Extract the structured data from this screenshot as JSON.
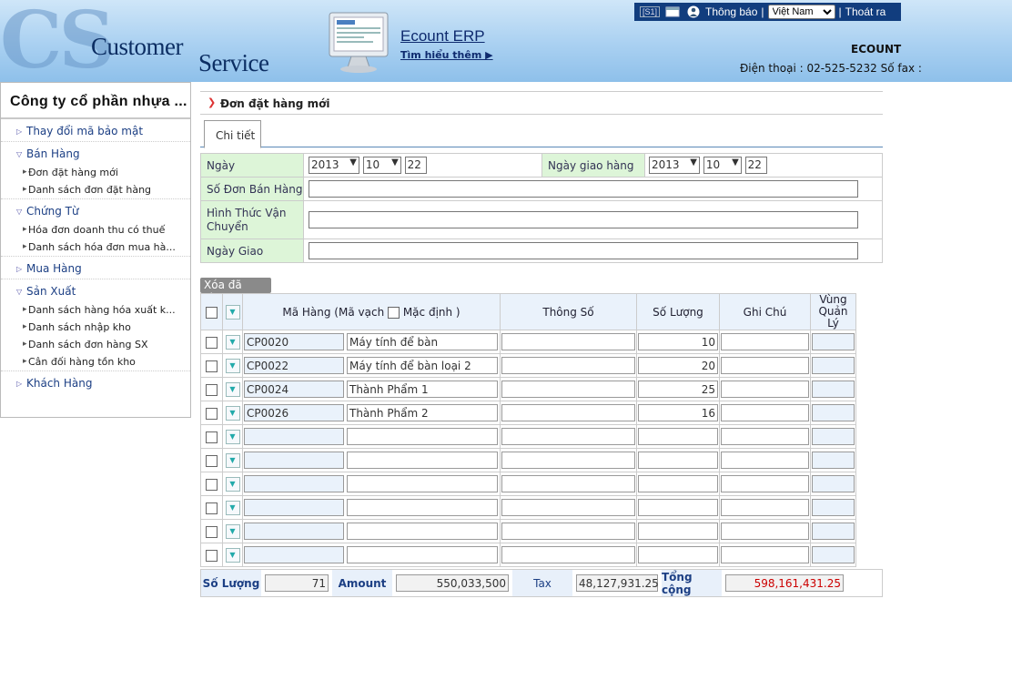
{
  "header": {
    "logo_letters": "CS",
    "logo_line1": "Customer",
    "logo_line2": "Service",
    "erp_link": "Ecount ERP",
    "learn_more": "Tìm hiểu thêm ▶",
    "s1_badge": "[S1]",
    "notifications": "Thông báo",
    "language": "Việt Nam",
    "logout": "Thoát ra",
    "company_code": "ECOUNT",
    "contact": "Điện thoại : 02-525-5232 Số fax :"
  },
  "sidebar": {
    "title": "Công ty cổ phần nhựa ...",
    "groups": [
      {
        "label": "Thay đổi mã bảo mật",
        "items": []
      },
      {
        "label": "Bán Hàng",
        "items": [
          "Đơn đặt hàng mới",
          "Danh sách đơn đặt hàng"
        ]
      },
      {
        "label": "Chứng Từ",
        "items": [
          "Hóa đơn doanh thu có thuế",
          "Danh sách hóa đơn mua hà..."
        ]
      },
      {
        "label": "Mua Hàng",
        "items": []
      },
      {
        "label": "Sản Xuất",
        "items": [
          "Danh sách hàng hóa xuất k...",
          "Danh sách nhập kho",
          "Danh sách đơn hàng SX",
          "Cân đối hàng tồn kho"
        ]
      },
      {
        "label": "Khách Hàng",
        "items": []
      }
    ]
  },
  "page": {
    "breadcrumb": "Đơn đặt hàng mới",
    "tab": "Chi tiết"
  },
  "form": {
    "date_label": "Ngày",
    "date_year": "2013",
    "date_month": "10",
    "date_day": "22",
    "delivery_date_label": "Ngày giao hàng",
    "delivery_year": "2013",
    "delivery_month": "10",
    "delivery_day": "22",
    "sales_no_label": "Số Đơn Bán Hàng",
    "shipping_label": "Hình Thức Vận Chuyển",
    "ship_date_label": "Ngày Giao"
  },
  "grid": {
    "delete_selected": "Xóa đã chọn",
    "col_code": "Mã Hàng (Mã vạch",
    "col_default": "Mặc định )",
    "col_spec": "Thông Số",
    "col_qty": "Số Lượng",
    "col_note": "Ghi Chú",
    "col_zone": "Vùng Quản Lý",
    "rows": [
      {
        "code": "CP0020",
        "name": "Máy tính để bàn",
        "spec": "",
        "qty": "10",
        "note": "",
        "zone": ""
      },
      {
        "code": "CP0022",
        "name": "Máy tính để bàn loại 2",
        "spec": "",
        "qty": "20",
        "note": "",
        "zone": ""
      },
      {
        "code": "CP0024",
        "name": "Thành Phẩm 1",
        "spec": "",
        "qty": "25",
        "note": "",
        "zone": ""
      },
      {
        "code": "CP0026",
        "name": "Thành Phẩm 2",
        "spec": "",
        "qty": "16",
        "note": "",
        "zone": ""
      },
      {
        "code": "",
        "name": "",
        "spec": "",
        "qty": "",
        "note": "",
        "zone": ""
      },
      {
        "code": "",
        "name": "",
        "spec": "",
        "qty": "",
        "note": "",
        "zone": ""
      },
      {
        "code": "",
        "name": "",
        "spec": "",
        "qty": "",
        "note": "",
        "zone": ""
      },
      {
        "code": "",
        "name": "",
        "spec": "",
        "qty": "",
        "note": "",
        "zone": ""
      },
      {
        "code": "",
        "name": "",
        "spec": "",
        "qty": "",
        "note": "",
        "zone": ""
      },
      {
        "code": "",
        "name": "",
        "spec": "",
        "qty": "",
        "note": "",
        "zone": ""
      }
    ]
  },
  "totals": {
    "qty_label": "Số Lượng",
    "qty_value": "71",
    "amount_label": "Amount",
    "amount_value": "550,033,500",
    "tax_label": "Tax",
    "tax_value": "48,127,931.25",
    "total_label": "Tổng cộng",
    "total_value": "598,161,431.25",
    "total_color": "#cc0000"
  }
}
